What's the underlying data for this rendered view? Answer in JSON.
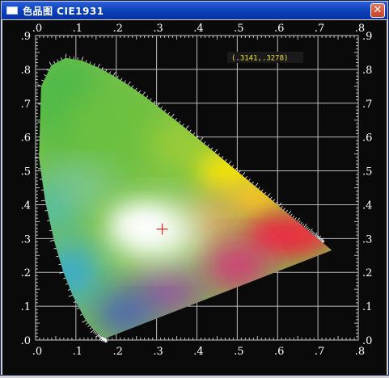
{
  "window": {
    "title": "色品图  CIE1931",
    "close_glyph": "✕",
    "colors": {
      "titlebar": "#0a3fb8",
      "panel": "#0a0a0a",
      "frame": "#d4d0c8"
    }
  },
  "readout": {
    "text": "(.3141,.3278)",
    "color": "#f0e040"
  },
  "icons": [
    "window-icon",
    "close-icon",
    "white-point-crosshair-icon"
  ],
  "chart_data": {
    "type": "scatter",
    "xlim": [
      0,
      0.8
    ],
    "ylim": [
      0,
      0.9
    ],
    "grid": true,
    "x_ticks": [
      ".0",
      ".1",
      ".2",
      ".3",
      ".4",
      ".5",
      ".6",
      ".7",
      ".8"
    ],
    "y_ticks": [
      ".0",
      ".1",
      ".2",
      ".3",
      ".4",
      ".5",
      ".6",
      ".7",
      ".8",
      ".9"
    ],
    "series": [
      {
        "points": [
          {
            "x": 0.3141,
            "y": 0.3278
          }
        ],
        "color": "#e03030"
      }
    ]
  }
}
